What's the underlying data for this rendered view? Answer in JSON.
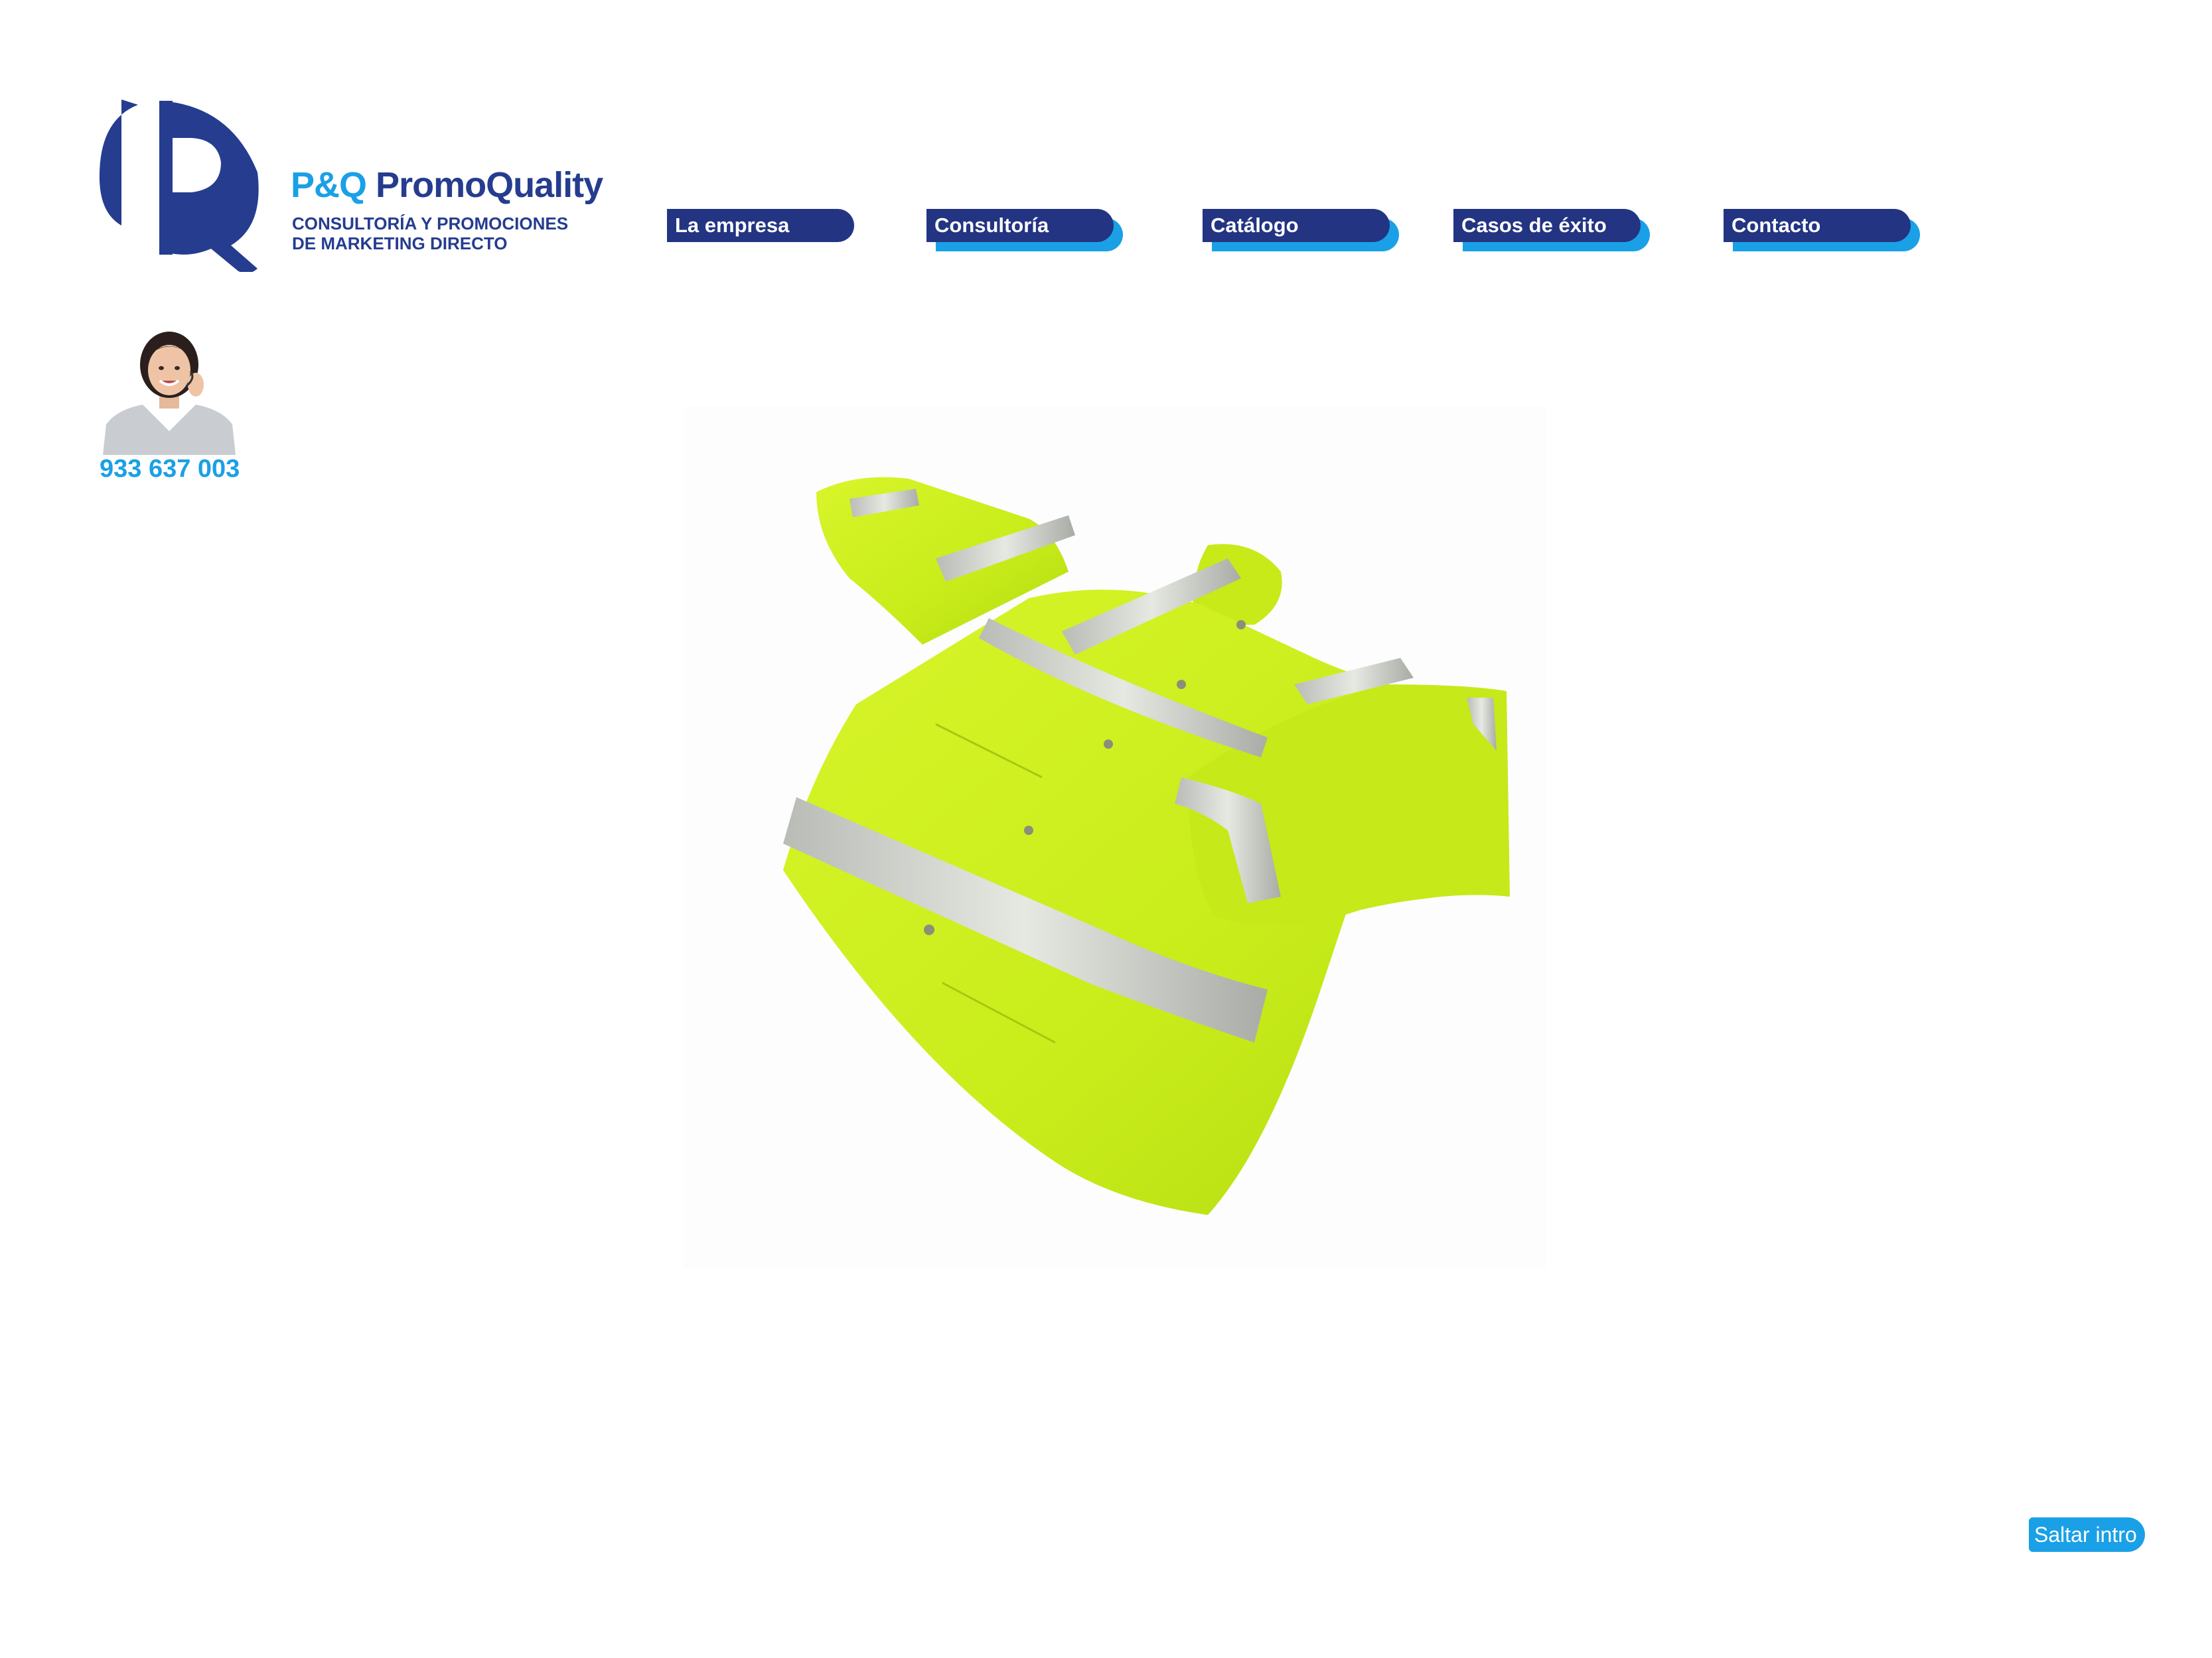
{
  "brand": {
    "name_part1": "P&Q",
    "name_part2": "PromoQuality",
    "tagline_line1": "CONSULTORÍA Y PROMOCIONES",
    "tagline_line2": "DE MARKETING DIRECTO",
    "colors": {
      "primary": "#253c8f",
      "accent": "#1aa0e6"
    }
  },
  "nav": {
    "items": [
      {
        "label": "La empresa"
      },
      {
        "label": "Consultoría"
      },
      {
        "label": "Catálogo"
      },
      {
        "label": "Casos de éxito"
      },
      {
        "label": "Contacto"
      }
    ]
  },
  "contact": {
    "phone": "933 637 003",
    "operator_icon": "customer-service-operator"
  },
  "main": {
    "product_image": "high-visibility-yellow-safety-jacket"
  },
  "footer": {
    "skip_intro_label": "Saltar intro"
  }
}
